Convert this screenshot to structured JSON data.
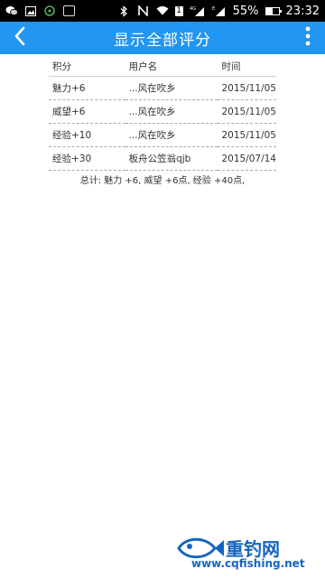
{
  "status_bar": {
    "battery_percent": "55%",
    "battery_level": 0.55,
    "time": "23:32",
    "network": "4G",
    "network_sub": "E",
    "sim_slot": "1",
    "left_icons": [
      "wechat-icon",
      "gallery-icon",
      "google-plus-icon",
      "empty-box-icon"
    ],
    "right_icons": [
      "bluetooth-icon",
      "nfc-icon",
      "wifi-icon",
      "signal-icon",
      "signal-icon"
    ]
  },
  "app_bar": {
    "title": "显示全部评分",
    "back_icon": "chevron-left-icon",
    "menu_icon": "more-vert-icon",
    "color": "#2196f3"
  },
  "table": {
    "headers": [
      "积分",
      "用户名",
      "时间"
    ],
    "rows": [
      {
        "score": "魅力+6",
        "user": "...风在吹乡",
        "date": "2015/11/05"
      },
      {
        "score": "威望+6",
        "user": "...风在吹乡",
        "date": "2015/11/05"
      },
      {
        "score": "经验+10",
        "user": "...风在吹乡",
        "date": "2015/11/05"
      },
      {
        "score": "经验+30",
        "user": "板舟公笠翁qjb",
        "date": "2015/07/14"
      }
    ]
  },
  "summary": "总计: 魅力 +6, 威望 +6点, 经验 +40点,",
  "watermark": {
    "brand": "重钓网",
    "url": "www.cqfishing.net",
    "color": "#1565c0"
  }
}
